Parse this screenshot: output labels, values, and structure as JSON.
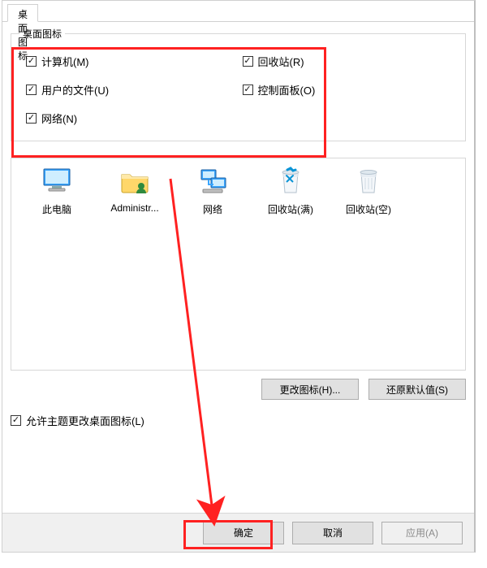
{
  "tab": "桌面图标",
  "fieldset_title": "桌面图标",
  "checkboxes": {
    "computer": {
      "label": "计算机(M)",
      "checked": true
    },
    "recycle": {
      "label": "回收站(R)",
      "checked": true
    },
    "userfiles": {
      "label": "用户的文件(U)",
      "checked": true
    },
    "controlpanel": {
      "label": "控制面板(O)",
      "checked": true
    },
    "network": {
      "label": "网络(N)",
      "checked": true
    }
  },
  "icons": [
    {
      "id": "this-pc",
      "label": "此电脑",
      "kind": "monitor"
    },
    {
      "id": "admin",
      "label": "Administr...",
      "kind": "folder-user"
    },
    {
      "id": "net",
      "label": "网络",
      "kind": "network"
    },
    {
      "id": "bin-full",
      "label": "回收站(满)",
      "kind": "bin-full"
    },
    {
      "id": "bin-empty",
      "label": "回收站(空)",
      "kind": "bin-empty"
    }
  ],
  "buttons": {
    "change_icon": "更改图标(H)...",
    "restore_default": "还原默认值(S)"
  },
  "allow_theme": {
    "label": "允许主题更改桌面图标(L)",
    "checked": true
  },
  "bottom": {
    "ok": "确定",
    "cancel": "取消",
    "apply": "应用(A)"
  },
  "annotations": {
    "highlight_checkbox_group": true,
    "highlight_ok_button": true,
    "arrow_from_checkboxes_to_ok": true,
    "color": "#ff2121"
  }
}
